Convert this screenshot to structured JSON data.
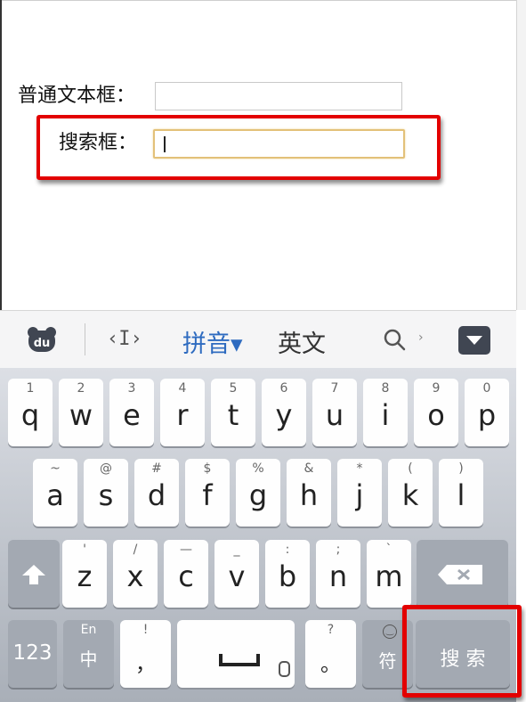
{
  "form": {
    "plain_label": "普通文本框：",
    "plain_value": "",
    "search_label": "搜索框：",
    "search_value": ""
  },
  "ime_bar": {
    "logo_text": "du",
    "cursor_symbol": "‹I›",
    "pinyin_label": "拼音▾",
    "english_label": "英文",
    "arrow_symbol": "›"
  },
  "keyboard": {
    "row1": [
      {
        "hint": "1",
        "key": "q"
      },
      {
        "hint": "2",
        "key": "w"
      },
      {
        "hint": "3",
        "key": "e"
      },
      {
        "hint": "4",
        "key": "r"
      },
      {
        "hint": "5",
        "key": "t"
      },
      {
        "hint": "6",
        "key": "y"
      },
      {
        "hint": "7",
        "key": "u"
      },
      {
        "hint": "8",
        "key": "i"
      },
      {
        "hint": "9",
        "key": "o"
      },
      {
        "hint": "0",
        "key": "p"
      }
    ],
    "row2": [
      {
        "hint": "~",
        "key": "a"
      },
      {
        "hint": "@",
        "key": "s"
      },
      {
        "hint": "#",
        "key": "d"
      },
      {
        "hint": "$",
        "key": "f"
      },
      {
        "hint": "%",
        "key": "g"
      },
      {
        "hint": "&",
        "key": "h"
      },
      {
        "hint": "*",
        "key": "j"
      },
      {
        "hint": "(",
        "key": "k"
      },
      {
        "hint": ")",
        "key": "l"
      }
    ],
    "row3": [
      {
        "hint": "'",
        "key": "z"
      },
      {
        "hint": "/",
        "key": "x"
      },
      {
        "hint": "—",
        "key": "c"
      },
      {
        "hint": "_",
        "key": "v"
      },
      {
        "hint": ":",
        "key": "b"
      },
      {
        "hint": ";",
        "key": "n"
      },
      {
        "hint": "`",
        "key": "m"
      }
    ],
    "num_label": "123",
    "lang_hint": "En",
    "lang_label": "中",
    "comma_hint": "!",
    "comma_label": "，",
    "period_hint": "?",
    "period_label": "。",
    "symbol_label": "符",
    "search_label": "搜 索"
  },
  "colors": {
    "highlight": "#e30000",
    "pinyin_accent": "#2e6bc0",
    "focus_border": "#e3c179"
  }
}
